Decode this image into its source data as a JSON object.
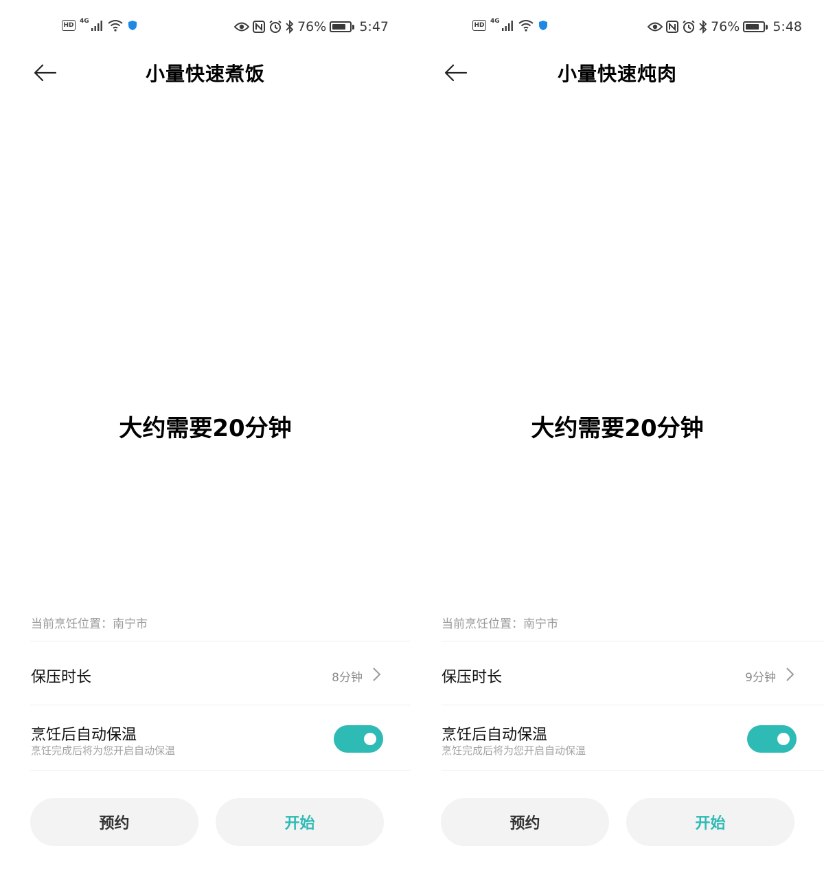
{
  "theme": {
    "accent": "#2ebab5",
    "button_bg": "#f3f3f3",
    "muted_text": "#9a9a9a"
  },
  "screens": [
    {
      "status": {
        "network": "4G",
        "battery": "76%",
        "battery_level": 0.76,
        "time": "5:47"
      },
      "title": "小量快速煮饭",
      "estimate": "大约需要20分钟",
      "location": "当前烹饪位置：南宁市",
      "pressure": {
        "label": "保压时长",
        "value": "8分钟"
      },
      "keep_warm": {
        "title": "烹饪后自动保温",
        "desc": "烹饪完成后将为您开启自动保温",
        "enabled": true
      },
      "buttons": {
        "reserve": "预约",
        "start": "开始"
      }
    },
    {
      "status": {
        "network": "4G",
        "battery": "76%",
        "battery_level": 0.76,
        "time": "5:48"
      },
      "title": "小量快速炖肉",
      "estimate": "大约需要20分钟",
      "location": "当前烹饪位置：南宁市",
      "pressure": {
        "label": "保压时长",
        "value": "9分钟"
      },
      "keep_warm": {
        "title": "烹饪后自动保温",
        "desc": "烹饪完成后将为您开启自动保温",
        "enabled": true
      },
      "buttons": {
        "reserve": "预约",
        "start": "开始"
      }
    }
  ]
}
